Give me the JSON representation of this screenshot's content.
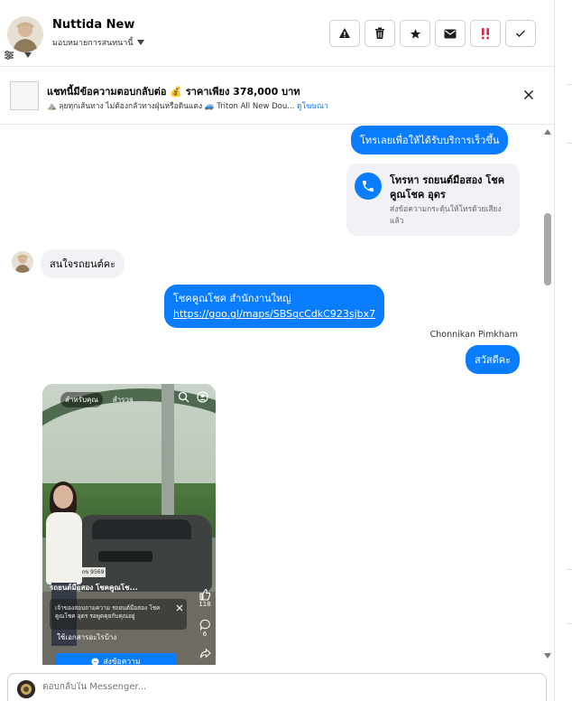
{
  "header": {
    "contact_name": "Nuttida New",
    "assign_label": "มอบหมายการสนทนานี้",
    "actions": [
      {
        "icon": "alert-triangle-icon",
        "name": "mark-spam-button"
      },
      {
        "icon": "trash-icon",
        "name": "delete-button"
      },
      {
        "icon": "star-icon",
        "name": "star-button"
      },
      {
        "icon": "envelope-icon",
        "name": "mark-unread-button"
      },
      {
        "icon": "follow-up-icon",
        "name": "follow-up-button"
      },
      {
        "icon": "checkmark-icon",
        "name": "mark-done-button"
      }
    ]
  },
  "banner": {
    "title": "แชทนี้มีข้อความตอบกลับต่อ 💰 ราคาเพียง 378,000 บาท",
    "subtitle": "⛰️ ลุยทุกเส้นทาง ไม่ต้องกลัวทางฝุ่นหรือดินแดง 🚙 Triton All New Dou...",
    "link": "ดูโฆษณา"
  },
  "messages": {
    "m1": "โทรเลยเพื่อให้ได้รับบริการเร็วขึ้น",
    "call_card": {
      "title": "โทรหา รถยนต์มือสอง โชคคูณโชค อุดร",
      "subtitle": "ส่งข้อความกระตุ้นให้โทรด้วยเสียงแล้ว"
    },
    "m3": "สนใจรถยนต์คะ",
    "m4_line1": "โชคคูณโชค สำนักงานใหญ่",
    "m4_link": "https://goo.gl/maps/SBSqcCdkC923sjbx7",
    "sender_name": "Chonnikan Pimkham",
    "m5": "สวัสดีคะ"
  },
  "video": {
    "tab_for_you": "สำหรับคุณ",
    "tab_explore": "สำรวจ",
    "like_count": "118",
    "comment_count": "6",
    "plate": "กข 9569",
    "caption": "รถยนต์มือสอง โชคคูณโช...",
    "popup_text": "เจ้าของสอบถามความ รถยนต์มือสอง โชคคูณโชค อุดร รอพูดคุยกับคุณอยู่",
    "sub_caption": "ใช้เอกสารอะไรบ้าง",
    "cta": "ส่งข้อความ"
  },
  "composer": {
    "placeholder": "ตอบกลับใน Messenger..."
  },
  "colors": {
    "accent": "#0a7cff",
    "incoming_bubble": "#f0f2f5",
    "border": "#ccd0d5"
  }
}
